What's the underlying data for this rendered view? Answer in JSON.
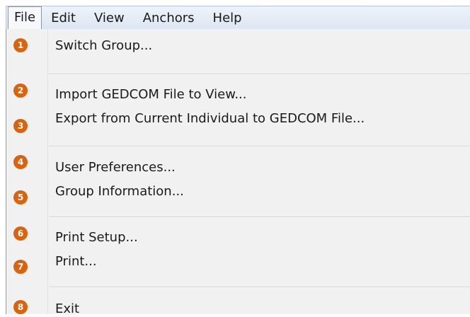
{
  "menubar": {
    "items": [
      {
        "label": "File"
      },
      {
        "label": "Edit"
      },
      {
        "label": "View"
      },
      {
        "label": "Anchors"
      },
      {
        "label": "Help"
      }
    ]
  },
  "file_menu": {
    "items": [
      {
        "number": "1",
        "label": "Switch Group..."
      },
      {
        "number": "2",
        "label": "Import GEDCOM File to View..."
      },
      {
        "number": "3",
        "label": "Export from Current Individual to GEDCOM File..."
      },
      {
        "number": "4",
        "label": "User Preferences..."
      },
      {
        "number": "5",
        "label": "Group Information..."
      },
      {
        "number": "6",
        "label": "Print Setup..."
      },
      {
        "number": "7",
        "label": "Print..."
      },
      {
        "number": "8",
        "label": "Exit"
      }
    ]
  },
  "colors": {
    "badge": "#d8640e",
    "menubar": "#dde6f2"
  }
}
